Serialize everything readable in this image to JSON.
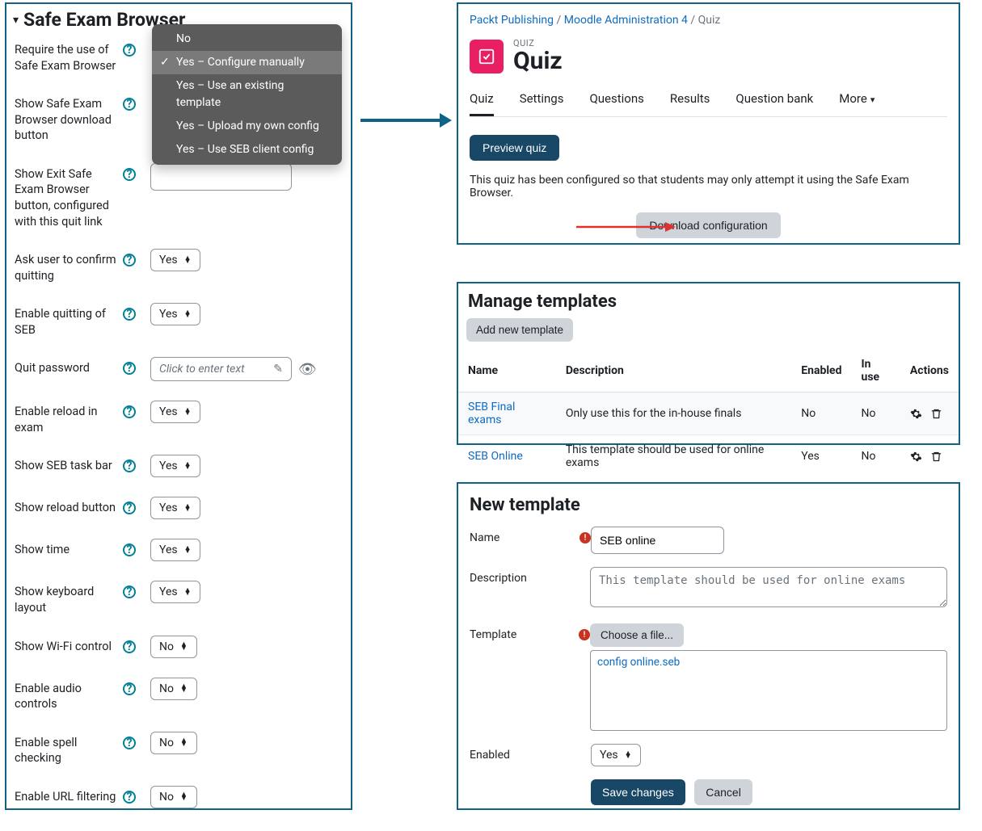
{
  "left": {
    "section_title": "Safe Exam Browser",
    "dropdown": {
      "options": [
        "No",
        "Yes – Configure manually",
        "Yes – Use an existing template",
        "Yes – Upload my own config",
        "Yes – Use SEB client config"
      ]
    },
    "rows": {
      "require": {
        "label": "Require the use of Safe Exam Browser"
      },
      "download_btn": {
        "label": "Show Safe Exam Browser download button"
      },
      "exit_btn": {
        "label": "Show Exit Safe Exam Browser button, configured with this quit link"
      },
      "confirm_quitting": {
        "label": "Ask user to confirm quitting",
        "value": "Yes"
      },
      "enable_quitting": {
        "label": "Enable quitting of SEB",
        "value": "Yes"
      },
      "quit_password": {
        "label": "Quit password",
        "placeholder": "Click to enter text"
      },
      "enable_reload": {
        "label": "Enable reload in exam",
        "value": "Yes"
      },
      "taskbar": {
        "label": "Show SEB task bar",
        "value": "Yes"
      },
      "reload_btn": {
        "label": "Show reload button",
        "value": "Yes"
      },
      "show_time": {
        "label": "Show time",
        "value": "Yes"
      },
      "keyboard": {
        "label": "Show keyboard layout",
        "value": "Yes"
      },
      "wifi": {
        "label": "Show Wi-Fi control",
        "value": "No"
      },
      "audio": {
        "label": "Enable audio controls",
        "value": "No"
      },
      "spell": {
        "label": "Enable spell checking",
        "value": "No"
      },
      "url_filter": {
        "label": "Enable URL filtering",
        "value": "No"
      }
    }
  },
  "quiz": {
    "breadcrumb": {
      "a": "Packt Publishing",
      "b": "Moodle Administration 4",
      "c": "Quiz",
      "sep": " / "
    },
    "badge": "QUIZ",
    "title": "Quiz",
    "tabs": {
      "quiz": "Quiz",
      "settings": "Settings",
      "questions": "Questions",
      "results": "Results",
      "qbank": "Question bank",
      "more": "More"
    },
    "preview_btn": "Preview quiz",
    "note": "This quiz has been configured so that students may only attempt it using the Safe Exam Browser.",
    "download_btn": "Download configuration"
  },
  "templates": {
    "heading": "Manage templates",
    "add_btn": "Add new template",
    "cols": {
      "name": "Name",
      "desc": "Description",
      "enabled": "Enabled",
      "inuse": "In use",
      "actions": "Actions"
    },
    "rows": [
      {
        "name": "SEB Final exams",
        "desc": "Only use this for the in-house finals",
        "enabled": "No",
        "inuse": "No"
      },
      {
        "name": "SEB Online",
        "desc": "This template should be used for online exams",
        "enabled": "Yes",
        "inuse": "No"
      }
    ]
  },
  "newtemplate": {
    "heading": "New template",
    "labels": {
      "name": "Name",
      "desc": "Description",
      "template": "Template",
      "enabled": "Enabled"
    },
    "name_value": "SEB online",
    "desc_value": "This template should be used for online exams",
    "choose_file": "Choose a file...",
    "file_name": "config online.seb",
    "enabled_value": "Yes",
    "save": "Save changes",
    "cancel": "Cancel"
  }
}
